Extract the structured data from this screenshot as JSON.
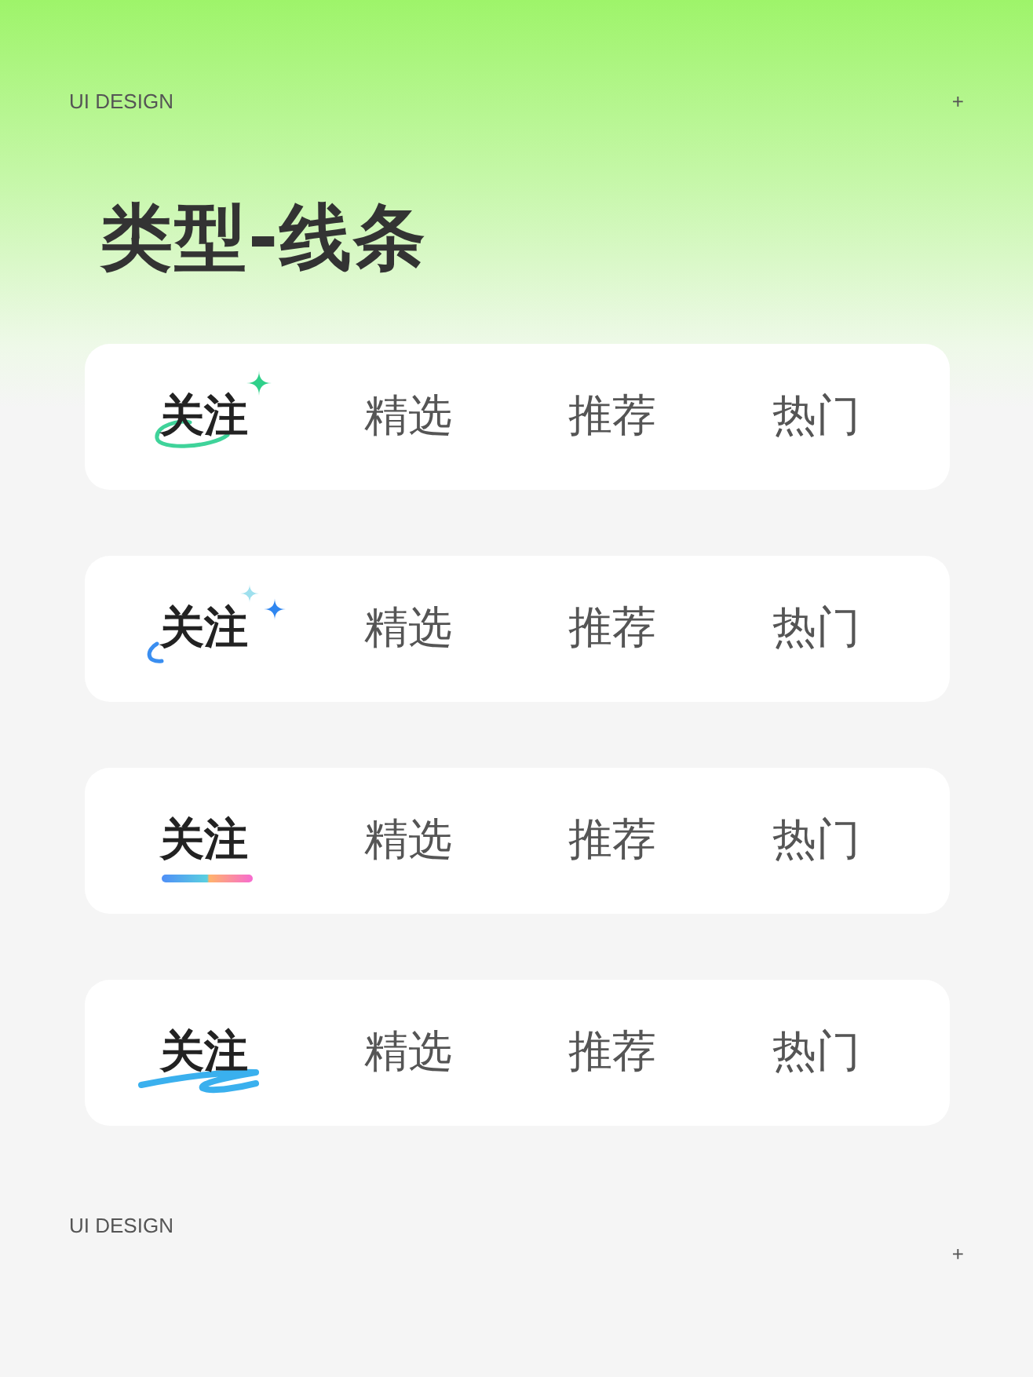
{
  "header": {
    "label": "UI DESIGN",
    "plus": "+"
  },
  "title": "类型-线条",
  "tab_bars": [
    {
      "kind": "ring",
      "tabs": [
        {
          "label": "关注",
          "selected": true
        },
        {
          "label": "精选",
          "selected": false
        },
        {
          "label": "推荐",
          "selected": false
        },
        {
          "label": "热门",
          "selected": false
        }
      ]
    },
    {
      "kind": "sparkle",
      "tabs": [
        {
          "label": "关注",
          "selected": true
        },
        {
          "label": "精选",
          "selected": false
        },
        {
          "label": "推荐",
          "selected": false
        },
        {
          "label": "热门",
          "selected": false
        }
      ]
    },
    {
      "kind": "gradient",
      "tabs": [
        {
          "label": "关注",
          "selected": true
        },
        {
          "label": "精选",
          "selected": false
        },
        {
          "label": "推荐",
          "selected": false
        },
        {
          "label": "热门",
          "selected": false
        }
      ]
    },
    {
      "kind": "scribble",
      "tabs": [
        {
          "label": "关注",
          "selected": true
        },
        {
          "label": "精选",
          "selected": false
        },
        {
          "label": "推荐",
          "selected": false
        },
        {
          "label": "热门",
          "selected": false
        }
      ]
    }
  ],
  "footer": {
    "label": "UI DESIGN",
    "plus": "+"
  }
}
